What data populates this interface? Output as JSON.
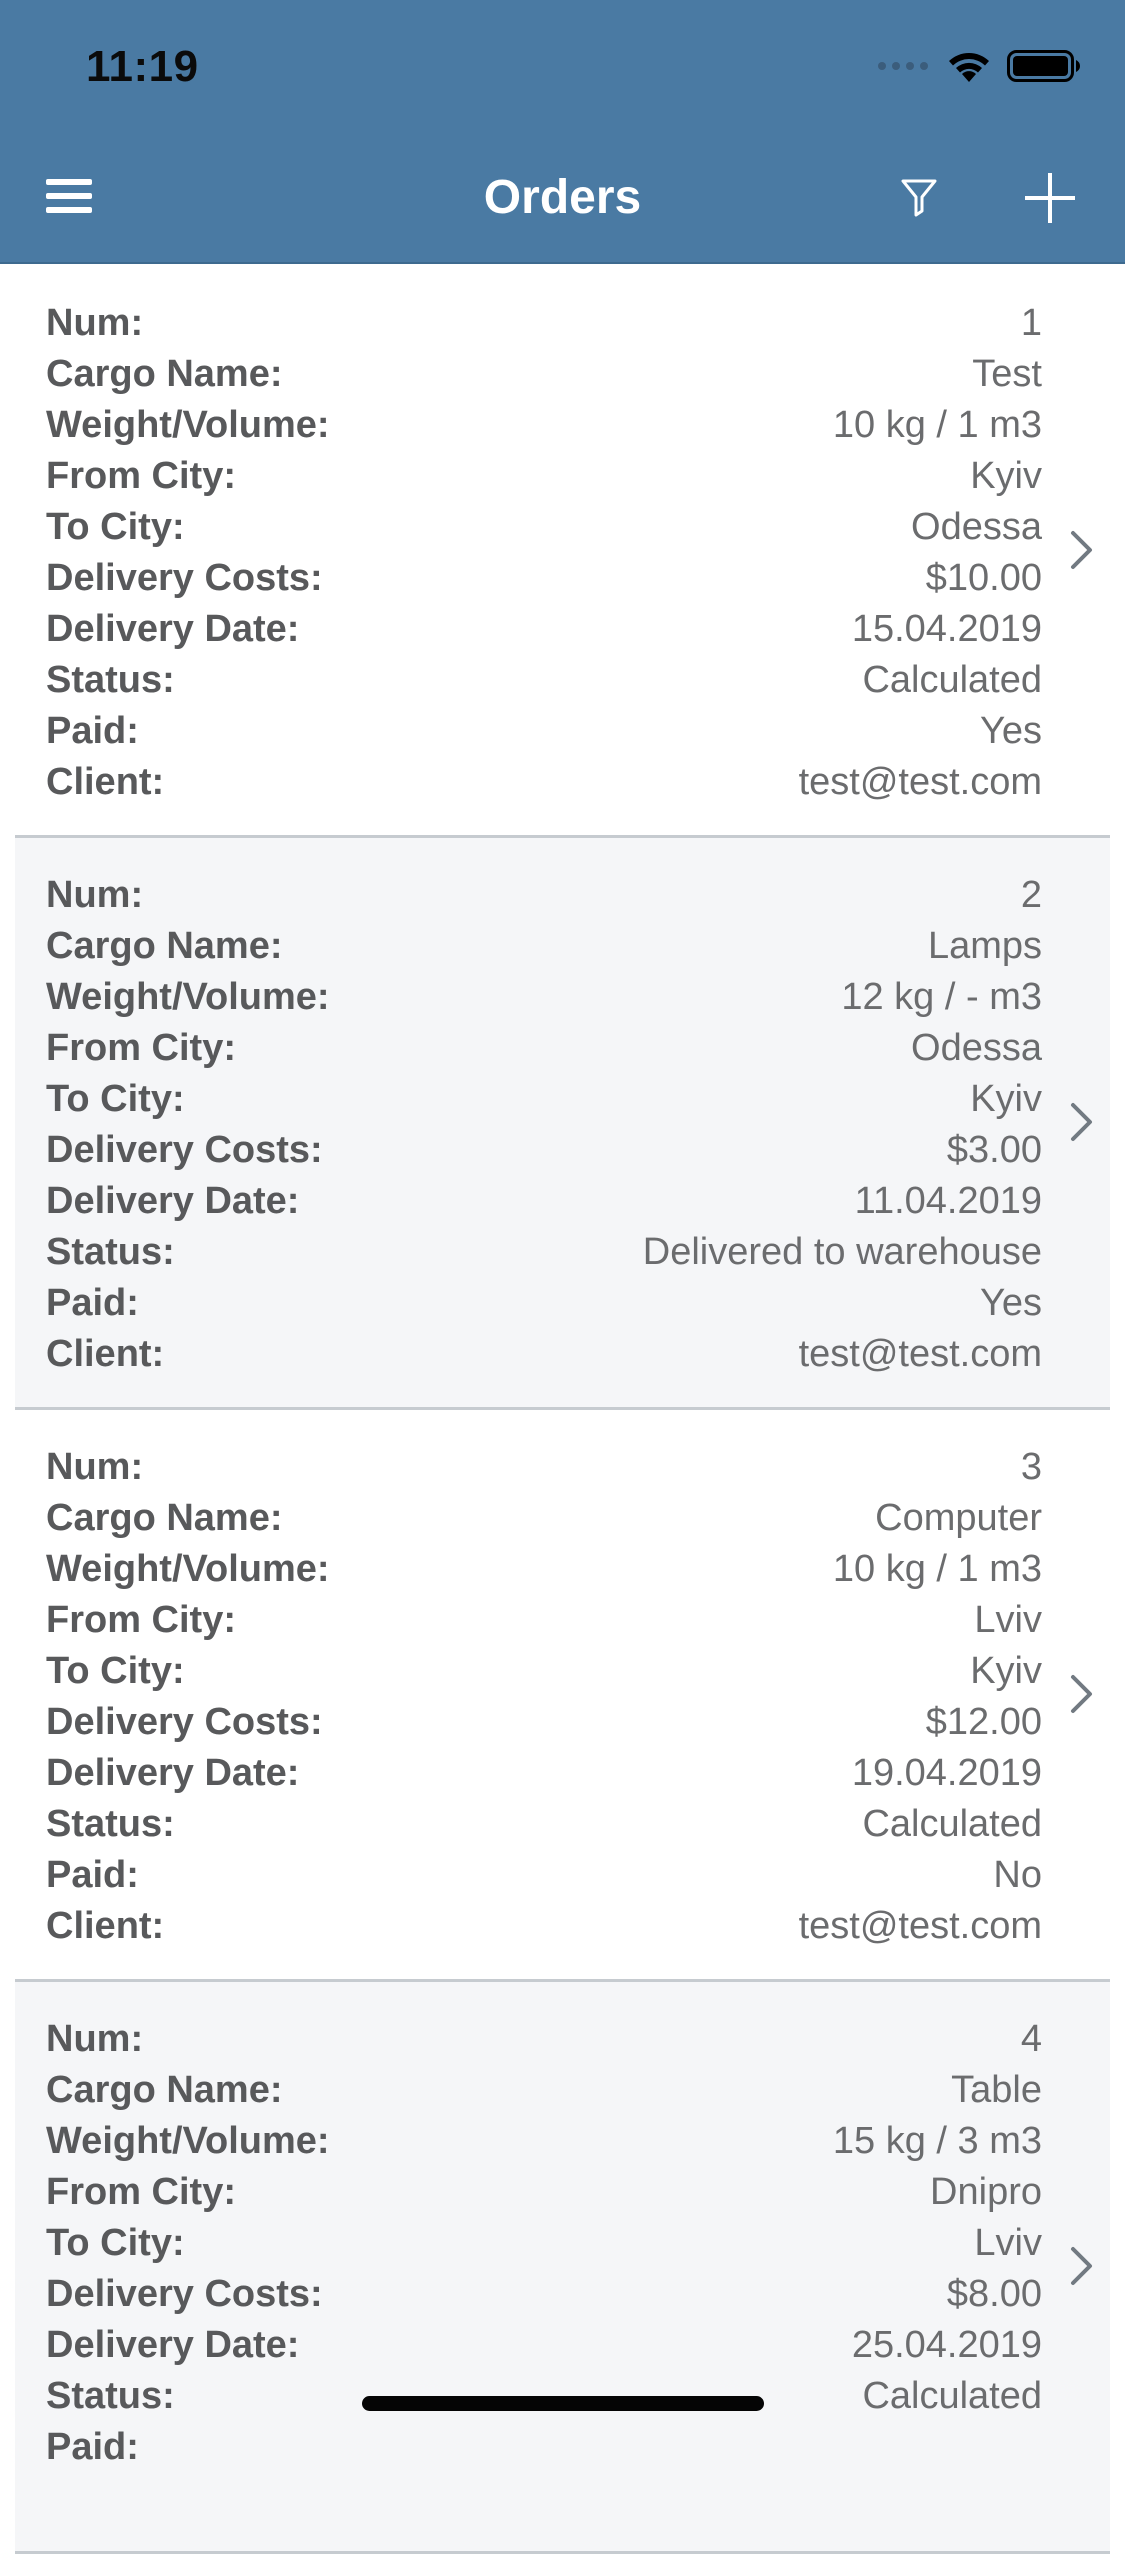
{
  "status_bar": {
    "time": "11:19"
  },
  "nav": {
    "title": "Orders"
  },
  "labels": {
    "num": "Num:",
    "cargo": "Cargo Name:",
    "weight": "Weight/Volume:",
    "from": "From City:",
    "to": "To City:",
    "costs": "Delivery Costs:",
    "date": "Delivery Date:",
    "status": "Status:",
    "paid": "Paid:",
    "client": "Client:"
  },
  "orders": [
    {
      "num": "1",
      "cargo": "Test",
      "weight": "10 kg / 1 m3",
      "from": "Kyiv",
      "to": "Odessa",
      "costs": "$10.00",
      "date": "15.04.2019",
      "status": "Calculated",
      "paid": "Yes",
      "client": "test@test.com"
    },
    {
      "num": "2",
      "cargo": "Lamps",
      "weight": "12 kg / - m3",
      "from": "Odessa",
      "to": "Kyiv",
      "costs": "$3.00",
      "date": "11.04.2019",
      "status": "Delivered to warehouse",
      "paid": "Yes",
      "client": "test@test.com"
    },
    {
      "num": "3",
      "cargo": "Computer",
      "weight": "10 kg / 1 m3",
      "from": "Lviv",
      "to": "Kyiv",
      "costs": "$12.00",
      "date": "19.04.2019",
      "status": "Calculated",
      "paid": "No",
      "client": "test@test.com"
    },
    {
      "num": "4",
      "cargo": "Table",
      "weight": "15 kg / 3 m3",
      "from": "Dnipro",
      "to": "Lviv",
      "costs": "$8.00",
      "date": "25.04.2019",
      "status": "Calculated",
      "paid": "",
      "client": ""
    }
  ],
  "icons": {
    "menu": "hamburger-menu-icon",
    "filter": "filter-icon",
    "add": "plus-icon",
    "disclosure": "chevron-right-icon"
  },
  "colors": {
    "nav_bar": "#4a7aa3",
    "alt_row": "#f5f6f8",
    "label_text": "#58595b",
    "value_text": "#6b6c6e"
  }
}
